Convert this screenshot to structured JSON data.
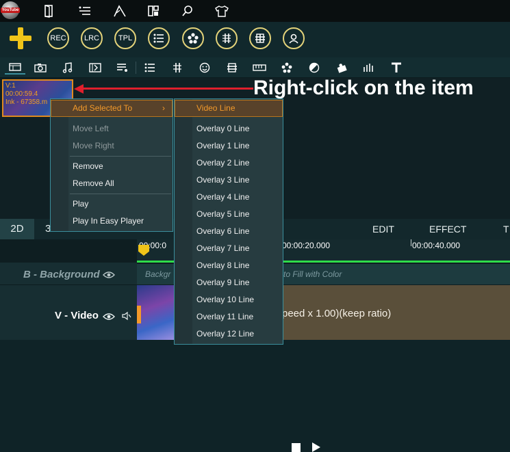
{
  "toolbar_top": {
    "logo_text": "YouTube"
  },
  "toolbar_circle_buttons": [
    "REC",
    "LRC",
    "TPL"
  ],
  "callout": "Right-click on the item",
  "clip": {
    "track": "V:1",
    "duration": "00:00:59.4",
    "name": "Ink - 67358.m"
  },
  "context_menu": {
    "items": [
      {
        "label": "Add Selected To",
        "state": "selected",
        "submenu": true
      },
      {
        "label": "Move Left",
        "state": "disabled"
      },
      {
        "label": "Move Right",
        "state": "disabled"
      },
      {
        "label": "Remove",
        "state": "normal"
      },
      {
        "label": "Remove All",
        "state": "normal"
      },
      {
        "label": "Play",
        "state": "normal"
      },
      {
        "label": "Play In Easy Player",
        "state": "normal"
      }
    ]
  },
  "submenu": {
    "items": [
      "Video Line",
      "Overlay 0 Line",
      "Overlay 1 Line",
      "Overlay 2 Line",
      "Overlay 3 Line",
      "Overlay 4 Line",
      "Overlay 5 Line",
      "Overlay 6 Line",
      "Overlay 7 Line",
      "Overlay 8 Line",
      "Overlay 9 Line",
      "Overlay 10 Line",
      "Overlay 11 Line",
      "Overlay 12 Line"
    ]
  },
  "timeline": {
    "tabs": [
      "2D",
      "3D"
    ],
    "mode_tabs": [
      "EDIT",
      "EFFECT",
      "T"
    ],
    "ruler_labels": [
      "00:00:0",
      "00:00:20.000",
      "00:00:40.000"
    ],
    "tracks": {
      "background": {
        "name": "B - Background",
        "hint_left": "Backgr",
        "hint_right": "to Fill with Color"
      },
      "video": {
        "name": "V - Video",
        "clip_text": "peed x 1.00)(keep ratio)"
      }
    }
  },
  "colors": {
    "accent": "#f39a2a",
    "callout_arrow": "#e01f2c",
    "timeline_marker": "#2edc4a",
    "circle_border": "#e4d37a",
    "add_icon": "#f0c419"
  }
}
